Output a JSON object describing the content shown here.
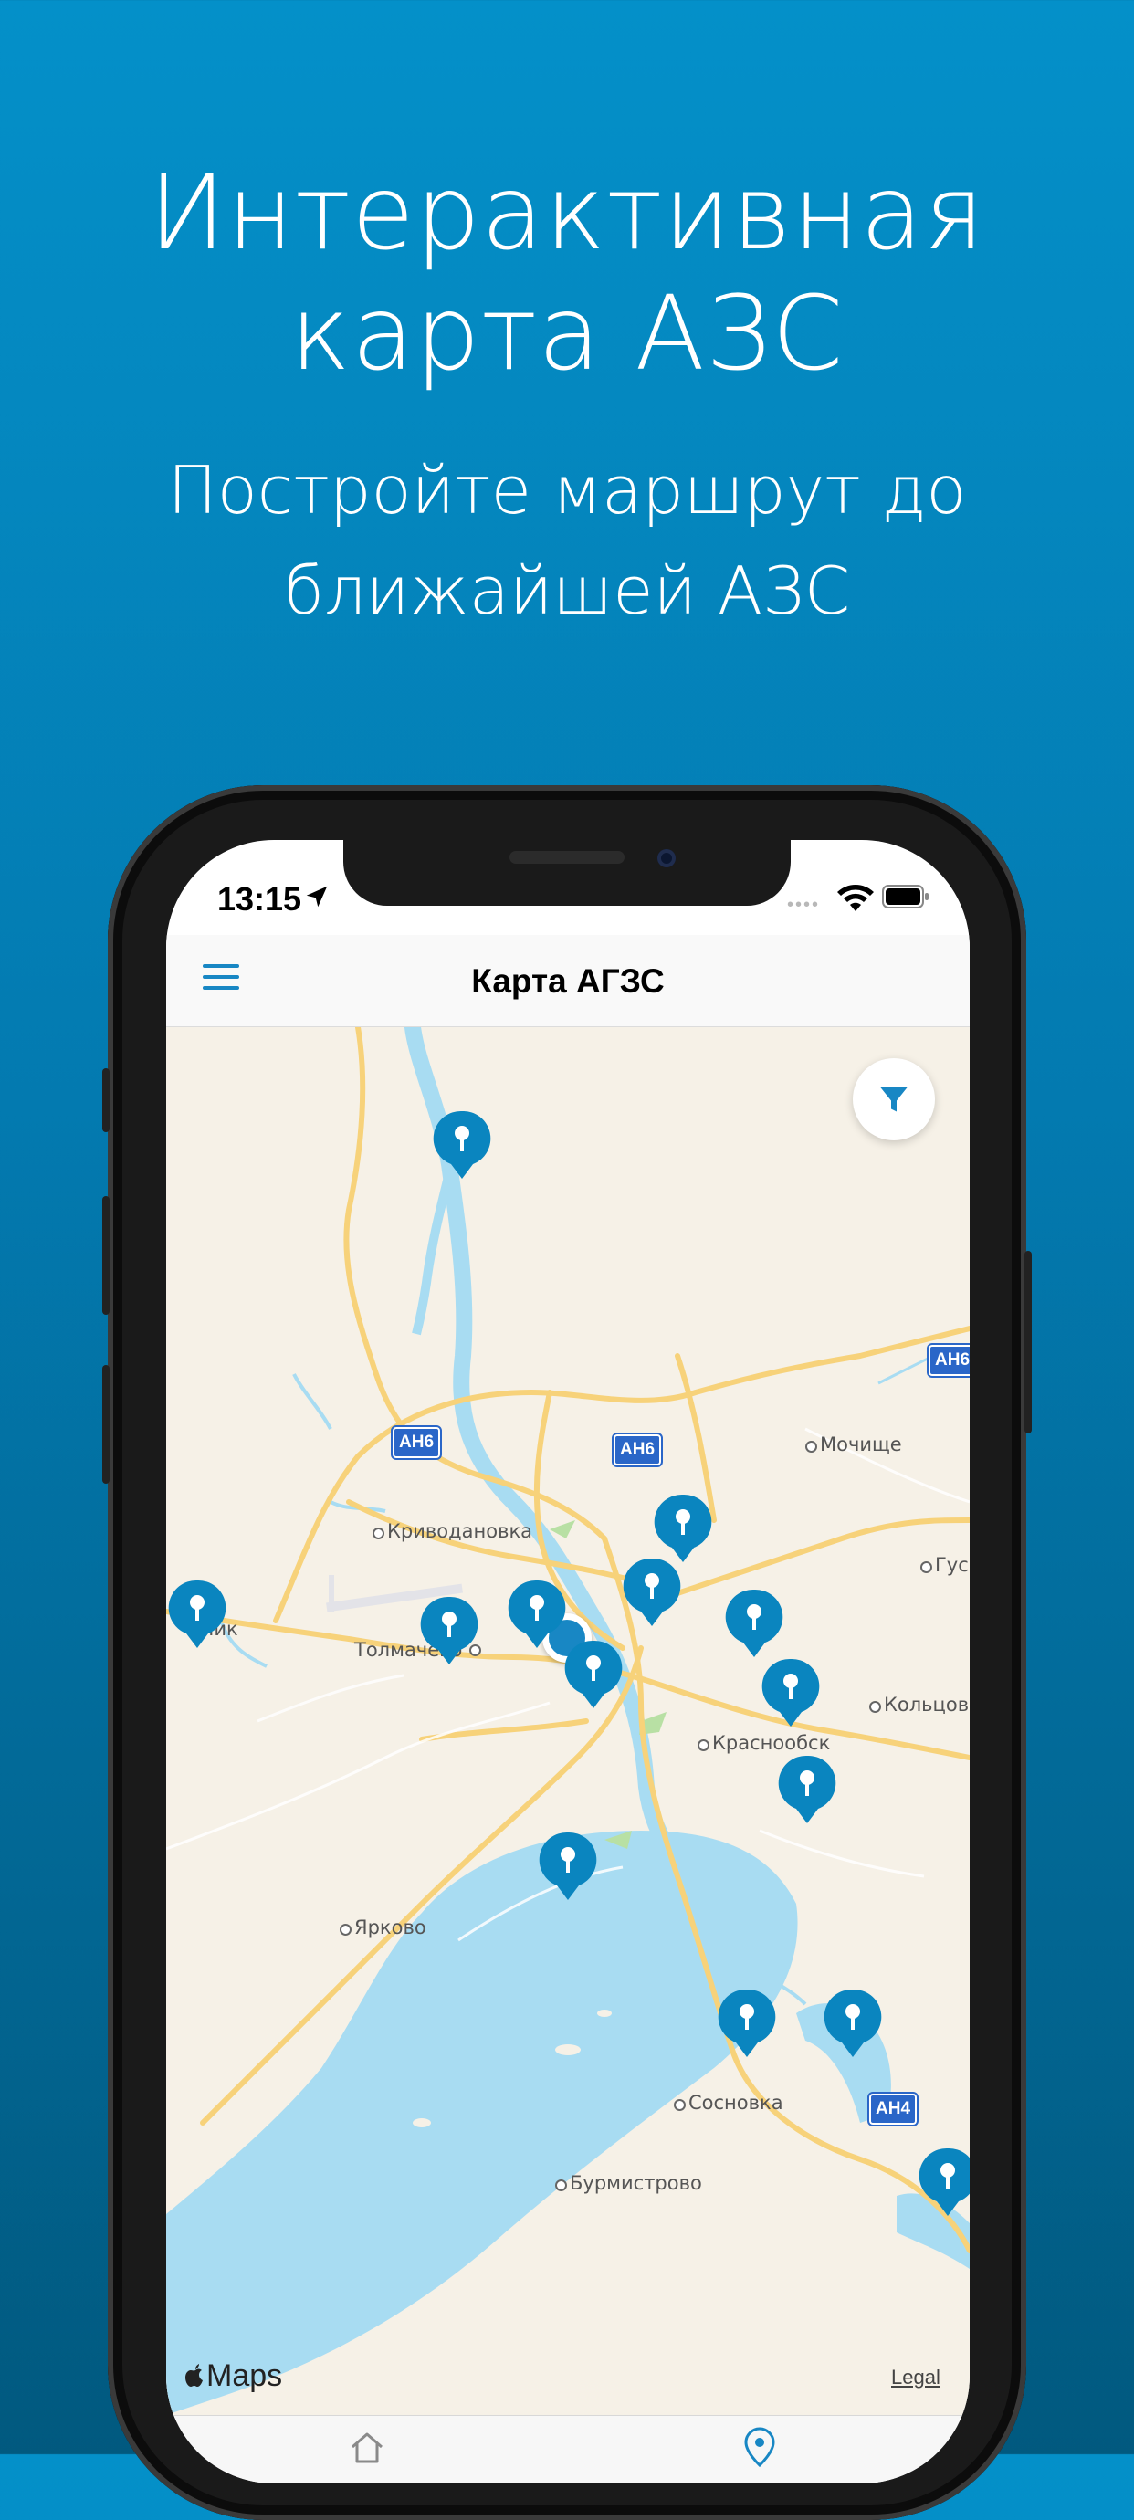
{
  "promo": {
    "headline_line1": "Интерактивная",
    "headline_line2": "карта АЗС",
    "subline_line1": "Постройте маршрут до",
    "subline_line2": "ближайшей АЗС"
  },
  "status_bar": {
    "time": "13:15",
    "signal_dots": "••••"
  },
  "nav": {
    "title": "Карта АГЗС"
  },
  "map": {
    "places": [
      "Мочище",
      "Криводановка",
      "Гус",
      "Чик",
      "Толмачево",
      "Кольцово",
      "Краснообск",
      "Ярково",
      "Сосновка",
      "Бурмистрово"
    ],
    "road_shields": [
      "АН6",
      "АН6",
      "АН6",
      "АН4"
    ],
    "attribution": "Maps",
    "legal": "Legal"
  },
  "icons": {
    "menu": "hamburger-menu-icon",
    "filter": "filter-icon",
    "pin": "gas-station-pin-icon",
    "home_tab": "home-icon",
    "map_tab": "map-pin-icon"
  },
  "colors": {
    "accent": "#1887c4",
    "water": "#a8dcf2",
    "road": "#f7d27a",
    "map_bg": "#f6f1e7"
  }
}
